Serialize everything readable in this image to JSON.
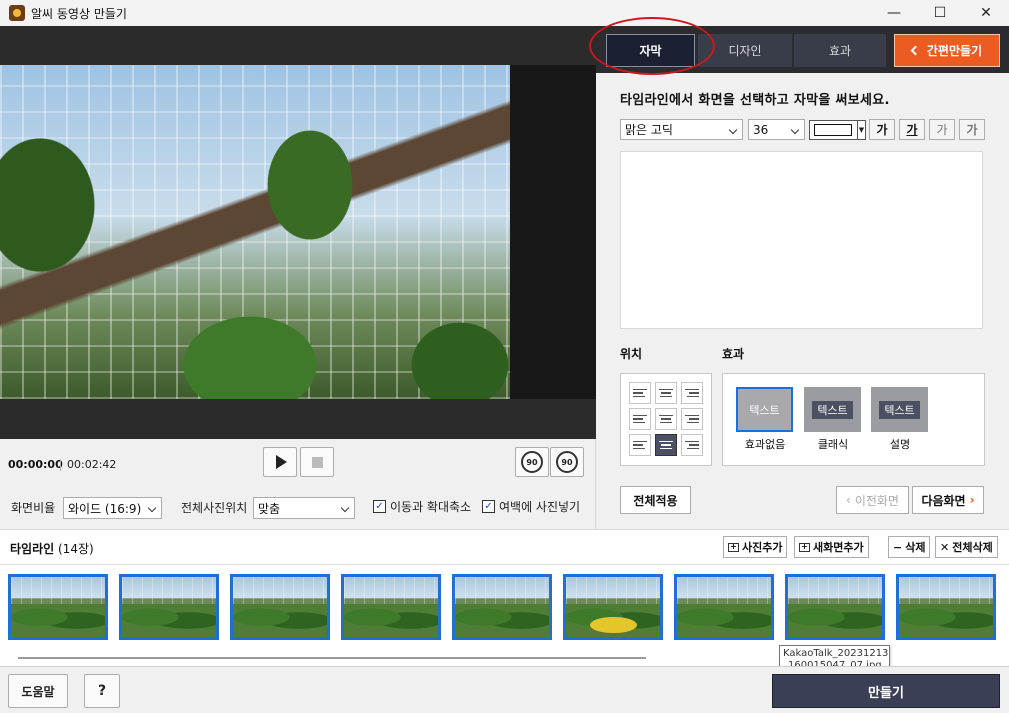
{
  "window": {
    "title": "알씨 동영상 만들기",
    "minimize": "—",
    "maximize": "☐",
    "close": "✕"
  },
  "player": {
    "current_time": "00:00:00",
    "duration": "00:02:42",
    "rotate_left_label": "90",
    "rotate_right_label": "90"
  },
  "options": {
    "aspect_label": "화면비율",
    "aspect_value": "와이드 (16:9)",
    "photo_pos_label": "전체사진위치",
    "photo_pos_value": "맞춤",
    "motion_zoom_label": "이동과 확대축소",
    "motion_zoom_checked": true,
    "fill_margin_label": "여백에 사진넣기",
    "fill_margin_checked": true
  },
  "tabs": [
    {
      "label": "자막",
      "active": true
    },
    {
      "label": "디자인",
      "active": false
    },
    {
      "label": "효과",
      "active": false
    }
  ],
  "easy_button": "간편만들기",
  "caption": {
    "instruction": "타임라인에서 화면을 선택하고 자막을 써보세요.",
    "font_value": "맑은 고딕",
    "size_value": "36",
    "text_color": "#ffffff",
    "format_buttons": [
      "가",
      "가",
      "가",
      "가"
    ],
    "text_value": ""
  },
  "position": {
    "title": "위치",
    "selected_index": 7
  },
  "effect": {
    "title": "효과",
    "items": [
      {
        "preview": "텍스트",
        "label": "효과없음",
        "selected": true
      },
      {
        "preview": "텍스트",
        "label": "클래식",
        "selected": false
      },
      {
        "preview": "텍스트",
        "label": "설명",
        "selected": false
      }
    ]
  },
  "buttons": {
    "apply_all": "전체적용",
    "prev_screen": "이전화면",
    "next_screen": "다음화면"
  },
  "timeline": {
    "title": "타임라인",
    "count": "(14장)",
    "add_photo": "사진추가",
    "add_blank": "새화면추가",
    "delete": "삭제",
    "delete_all": "전체삭제",
    "tooltip_line1": "KakaoTalk_20231213",
    "tooltip_line2": "_160015047_07.jpg"
  },
  "footer": {
    "help": "도움말",
    "question": "?",
    "make": "만들기"
  },
  "colors": {
    "accent_orange": "#ec5b21",
    "selection_blue": "#1f6fd6",
    "dark_panel": "#2b2b30",
    "make_button": "#3b3f55"
  }
}
